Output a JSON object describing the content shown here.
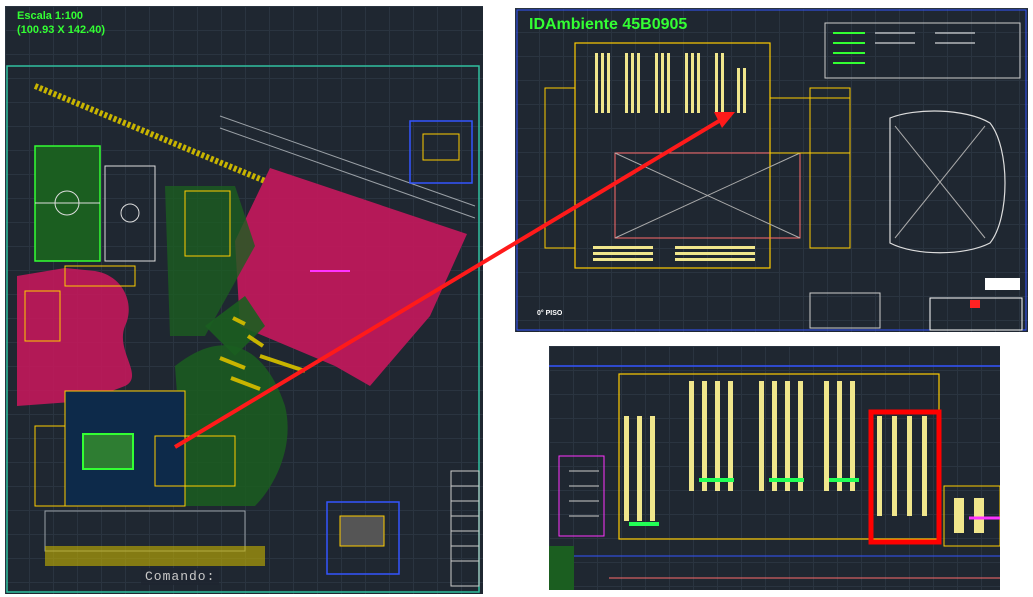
{
  "left_view": {
    "scale_line1": "Escala 1:100",
    "scale_line2": "(100.93 X 142.40)",
    "command_label": "Comando:"
  },
  "top_right_view": {
    "title": "IDAmbiente 45B0905",
    "floor_label": "0° PISO"
  },
  "bottom_right_view": {},
  "colors": {
    "background": "#1f2731",
    "magenta_zone": "#c2185b",
    "green_zone": "#1b5e20",
    "label_green": "#33ff33",
    "pointer_arrow": "#ff1a1a",
    "highlight_box": "#ff0000"
  },
  "icons": {
    "arrow": "red-pointer-arrow"
  }
}
